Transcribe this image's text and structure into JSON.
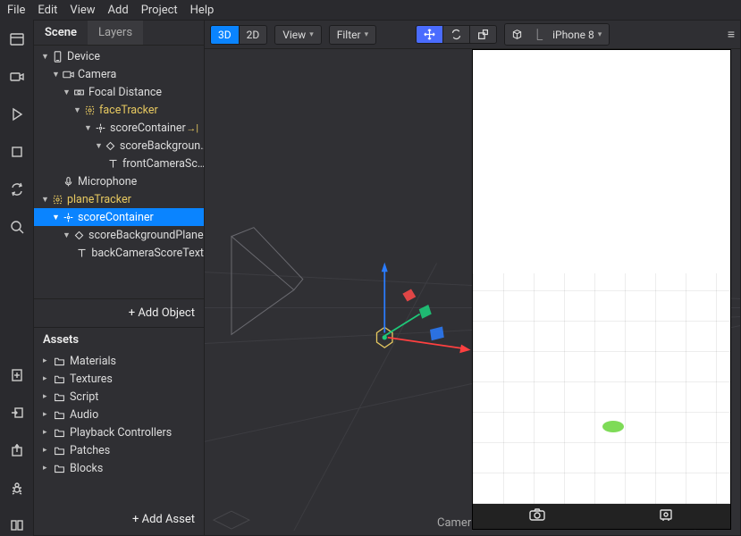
{
  "menu": {
    "items": [
      "File",
      "Edit",
      "View",
      "Add",
      "Project",
      "Help"
    ]
  },
  "left_tools": [
    "layout",
    "camera",
    "play",
    "stop",
    "loop",
    "search"
  ],
  "left_tools_bottom": [
    "add-file",
    "import",
    "export",
    "bug",
    "library"
  ],
  "scene": {
    "tab_scene": "Scene",
    "tab_layers": "Layers",
    "add_label": "+  Add Object",
    "tree": [
      {
        "depth": 0,
        "tog": "▼",
        "icon": "device",
        "label": "Device"
      },
      {
        "depth": 1,
        "tog": "▼",
        "icon": "camera",
        "label": "Camera"
      },
      {
        "depth": 2,
        "tog": "▼",
        "icon": "focal",
        "label": "Focal Distance"
      },
      {
        "depth": 3,
        "tog": "▼",
        "icon": "face",
        "label": "faceTracker",
        "yellow": true
      },
      {
        "depth": 4,
        "tog": "▼",
        "icon": "null",
        "label": "scoreContainer",
        "link": "→|"
      },
      {
        "depth": 5,
        "tog": "▼",
        "icon": "plane",
        "label": "scoreBackgroun…"
      },
      {
        "depth": 6,
        "tog": "",
        "icon": "text",
        "label": "frontCameraSc…"
      },
      {
        "depth": 1,
        "tog": "",
        "icon": "mic",
        "label": "Microphone"
      },
      {
        "depth": 0,
        "tog": "▼",
        "icon": "face",
        "label": "planeTracker",
        "yellow": true
      },
      {
        "depth": 1,
        "tog": "▼",
        "icon": "null",
        "label": "scoreContainer",
        "sel": true
      },
      {
        "depth": 2,
        "tog": "▼",
        "icon": "plane",
        "label": "scoreBackgroundPlane"
      },
      {
        "depth": 3,
        "tog": "",
        "icon": "text",
        "label": "backCameraScoreText"
      }
    ]
  },
  "assets": {
    "title": "Assets",
    "add_label": "+  Add Asset",
    "items": [
      {
        "label": "Materials"
      },
      {
        "label": "Textures"
      },
      {
        "label": "Script"
      },
      {
        "label": "Audio"
      },
      {
        "label": "Playback Controllers"
      },
      {
        "label": "Patches"
      },
      {
        "label": "Blocks"
      }
    ]
  },
  "viewport": {
    "mode_3d": "3D",
    "mode_2d": "2D",
    "view": "View",
    "filter": "Filter",
    "device_label": "iPhone 8",
    "footer": "Camer"
  }
}
